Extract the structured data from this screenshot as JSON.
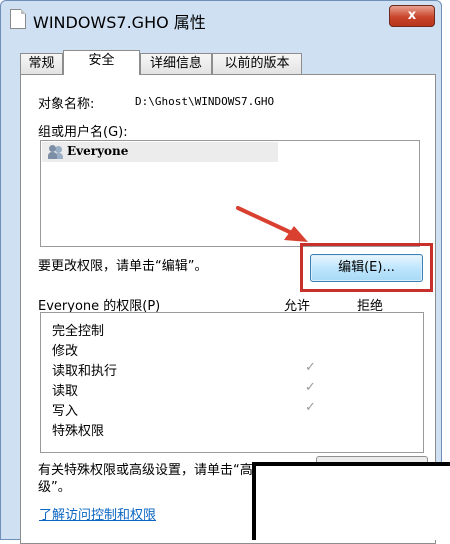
{
  "window": {
    "title": "WINDOWS7.GHO 属性",
    "close_label": "x"
  },
  "tabs": [
    {
      "label": "常规"
    },
    {
      "label": "安全"
    },
    {
      "label": "详细信息"
    },
    {
      "label": "以前的版本"
    }
  ],
  "active_tab": "安全",
  "object": {
    "label": "对象名称:",
    "value": "D:\\Ghost\\WINDOWS7.GHO"
  },
  "users": {
    "label": "组或用户名(G):",
    "items": [
      {
        "name": "Everyone",
        "icon": "users-icon"
      }
    ]
  },
  "edit": {
    "hint": "要更改权限，请单击“编辑”。",
    "button_label": "编辑(E)..."
  },
  "permissions": {
    "label": "Everyone 的权限(P)",
    "allow_header": "允许",
    "deny_header": "拒绝",
    "rows": [
      {
        "name": "完全控制",
        "allow": false,
        "deny": false
      },
      {
        "name": "修改",
        "allow": false,
        "deny": false
      },
      {
        "name": "读取和执行",
        "allow": true,
        "deny": false
      },
      {
        "name": "读取",
        "allow": true,
        "deny": false
      },
      {
        "name": "写入",
        "allow": true,
        "deny": false
      },
      {
        "name": "特殊权限",
        "allow": false,
        "deny": false
      }
    ],
    "check_glyph": "✓"
  },
  "advanced": {
    "hint_line1": "有关特殊权限或高级设置，请单击“高",
    "hint_line2": "级”。"
  },
  "link_text": "了解访问控制和权限",
  "annotation_color": "#c8312b"
}
